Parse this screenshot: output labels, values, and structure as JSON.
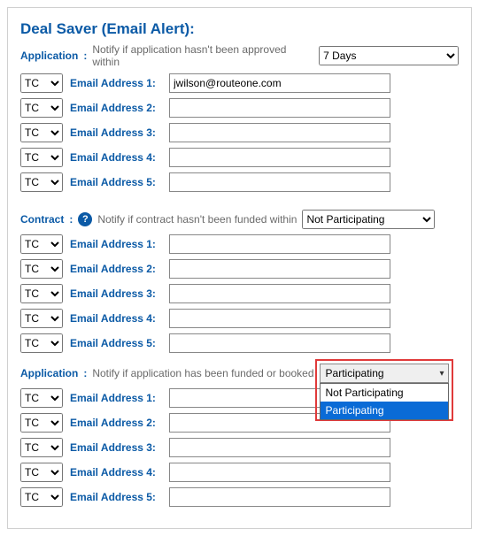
{
  "title": "Deal Saver (Email Alert):",
  "sections": {
    "app1": {
      "label": "Application",
      "hint": "Notify if application hasn't been approved within",
      "period_value": "7 Days",
      "rows": [
        {
          "tc": "TC",
          "label": "Email Address 1:",
          "value": "jwilson@routeone.com"
        },
        {
          "tc": "TC",
          "label": "Email Address 2:",
          "value": ""
        },
        {
          "tc": "TC",
          "label": "Email Address 3:",
          "value": ""
        },
        {
          "tc": "TC",
          "label": "Email Address 4:",
          "value": ""
        },
        {
          "tc": "TC",
          "label": "Email Address 5:",
          "value": ""
        }
      ]
    },
    "contract": {
      "label": "Contract",
      "help": "?",
      "hint": "Notify if contract hasn't been funded within",
      "period_value": "Not Participating",
      "rows": [
        {
          "tc": "TC",
          "label": "Email Address 1:",
          "value": ""
        },
        {
          "tc": "TC",
          "label": "Email Address 2:",
          "value": ""
        },
        {
          "tc": "TC",
          "label": "Email Address 3:",
          "value": ""
        },
        {
          "tc": "TC",
          "label": "Email Address 4:",
          "value": ""
        },
        {
          "tc": "TC",
          "label": "Email Address 5:",
          "value": ""
        }
      ]
    },
    "app2": {
      "label": "Application",
      "hint": "Notify if application has been funded or booked",
      "period_value": "Participating",
      "period_options": [
        "Not Participating",
        "Participating"
      ],
      "rows": [
        {
          "tc": "TC",
          "label": "Email Address 1:",
          "value": ""
        },
        {
          "tc": "TC",
          "label": "Email Address 2:",
          "value": ""
        },
        {
          "tc": "TC",
          "label": "Email Address 3:",
          "value": ""
        },
        {
          "tc": "TC",
          "label": "Email Address 4:",
          "value": ""
        },
        {
          "tc": "TC",
          "label": "Email Address 5:",
          "value": ""
        }
      ]
    }
  }
}
